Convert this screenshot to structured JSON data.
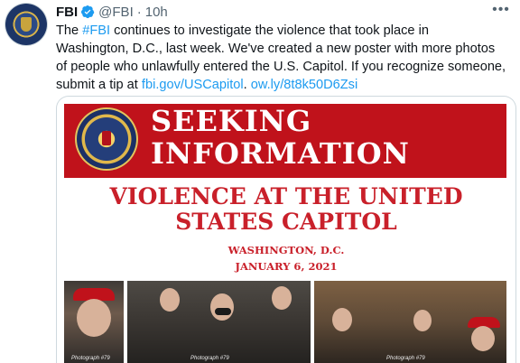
{
  "tweet": {
    "author_name": "FBI",
    "handle": "@FBI",
    "separator": "·",
    "time": "10h",
    "more_label": "•••",
    "lines": [
      {
        "parts": [
          {
            "t": "The ",
            "link": false
          },
          {
            "t": "#FBI",
            "link": true
          },
          {
            "t": " continues to investigate the violence that took place in",
            "link": false
          }
        ]
      },
      {
        "parts": [
          {
            "t": "Washington, D.C., last week. We've created a new poster with more photos",
            "link": false
          }
        ]
      },
      {
        "parts": [
          {
            "t": "of people who unlawfully entered the U.S. Capitol. If you recognize someone,",
            "link": false
          }
        ]
      },
      {
        "parts": [
          {
            "t": "submit a tip at ",
            "link": false
          },
          {
            "t": "fbi.gov/USCapitol",
            "link": true
          },
          {
            "t": ". ",
            "link": false
          },
          {
            "t": "ow.ly/8t8k50D6Zsi",
            "link": true
          }
        ]
      }
    ]
  },
  "poster": {
    "headline_1": "SEEKING",
    "headline_2": "INFORMATION",
    "sub_1": "VIOLENCE AT THE UNITED",
    "sub_2": "STATES CAPITOL",
    "location": "WASHINGTON, D.C.",
    "date": "JANUARY 6, 2021",
    "captions": [
      "Photograph #79",
      "Photograph #79",
      "Photograph #79"
    ]
  },
  "colors": {
    "link": "#1d9bf0",
    "poster_red": "#c0121b",
    "poster_text_red": "#c9202a",
    "verified": "#1d9bf0"
  }
}
